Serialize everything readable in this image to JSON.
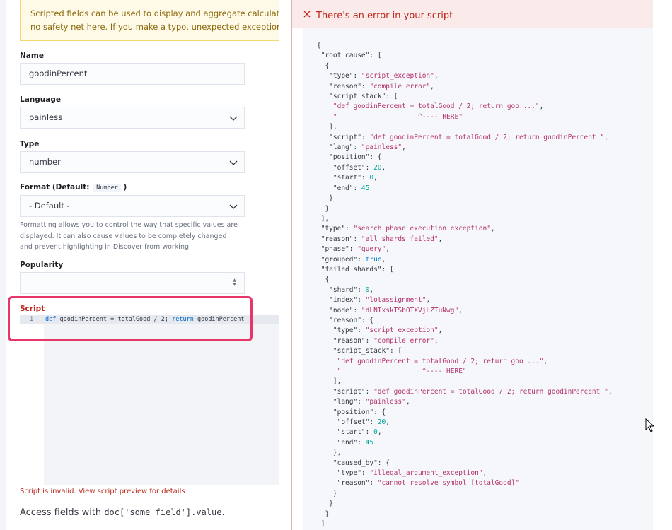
{
  "form": {
    "callout": {
      "line1": "Scripted fields can be used to display and aggregate calculated val",
      "line2": "no safety net here. If you make a typo, unexpected exceptions will b"
    },
    "name": {
      "label": "Name",
      "value": "goodinPercent"
    },
    "language": {
      "label": "Language",
      "value": "painless"
    },
    "type": {
      "label": "Type",
      "value": "number"
    },
    "format": {
      "label": "Format (Default:",
      "default_badge": "Number",
      "label_close": ")",
      "value": "- Default -",
      "help": "Formatting allows you to control the way that specific values are displayed. It can also cause values to be completely changed and prevent highlighting in Discover from working."
    },
    "popularity": {
      "label": "Popularity",
      "value": ""
    },
    "script": {
      "label": "Script",
      "line_number": "1",
      "code_kw1": "def",
      "code_mid": " goodinPercent = totalGood / 2; ",
      "code_kw2": "return",
      "code_end": " goodinPercent",
      "invalid_text": "Script is invalid. View script preview for details"
    },
    "access": {
      "prefix": "Access fields with ",
      "code": "doc['some_field'].value",
      "suffix": "."
    }
  },
  "error_flyout": {
    "title": "There's an error in your script",
    "close_icon": "close-icon",
    "json_text": "{\n \"root_cause\": [\n  {\n   \"type\": \"script_exception\",\n   \"reason\": \"compile error\",\n   \"script_stack\": [\n    \"def goodinPercent = totalGood / 2; return goo ...\",\n    \"                    ^---- HERE\"\n   ],\n   \"script\": \"def goodinPercent = totalGood / 2; return goodinPercent \",\n   \"lang\": \"painless\",\n   \"position\": {\n    \"offset\": 20,\n    \"start\": 0,\n    \"end\": 45\n   }\n  }\n ],\n \"type\": \"search_phase_execution_exception\",\n \"reason\": \"all shards failed\",\n \"phase\": \"query\",\n \"grouped\": true,\n \"failed_shards\": [\n  {\n   \"shard\": 0,\n   \"index\": \"lotassignment\",\n   \"node\": \"dLNIxskTSbOTXVjLZTuNwg\",\n   \"reason\": {\n    \"type\": \"script_exception\",\n    \"reason\": \"compile error\",\n    \"script_stack\": [\n     \"def goodinPercent = totalGood / 2; return goo ...\",\n     \"                    ^---- HERE\"\n    ],\n    \"script\": \"def goodinPercent = totalGood / 2; return goodinPercent \",\n    \"lang\": \"painless\",\n    \"position\": {\n     \"offset\": 20,\n     \"start\": 0,\n     \"end\": 45\n    },\n    \"caused_by\": {\n     \"type\": \"illegal_argument_exception\",\n     \"reason\": \"cannot resolve symbol [totalGood]\"\n    }\n   }\n  }\n ]"
  },
  "colors": {
    "error_red": "#bd271e",
    "highlight_pink": "#e8366b",
    "string_color": "#b5336e",
    "number_color": "#00a69b"
  }
}
